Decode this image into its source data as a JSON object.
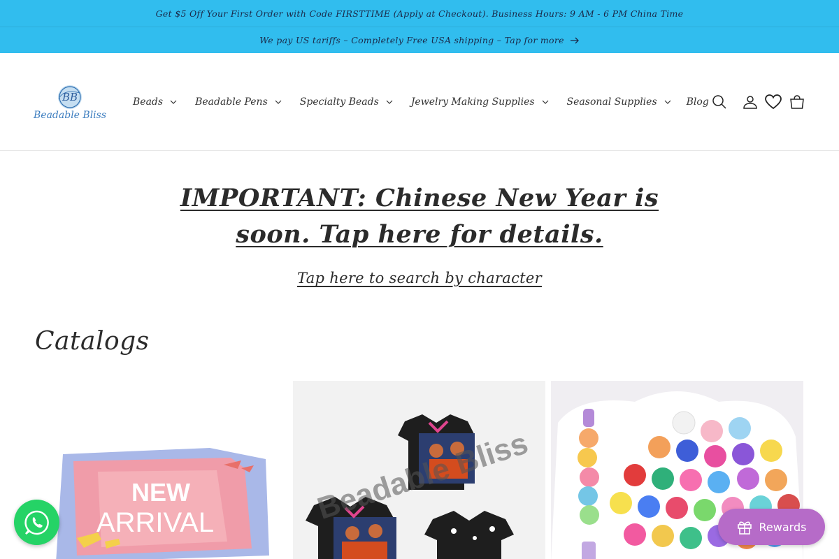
{
  "announcement_bar": {
    "promo_text": "Get $5 Off Your First Order with Code FIRSTTIME (Apply at Checkout). Business Hours: 9 AM - 6 PM China Time",
    "shipping_text": "We pay US tariffs – Completely Free USA shipping – Tap for more"
  },
  "header": {
    "logo": {
      "monogram": "BB",
      "text": "Beadable Bliss"
    },
    "nav": [
      {
        "label": "Beads"
      },
      {
        "label": "Beadable Pens"
      },
      {
        "label": "Specialty Beads"
      },
      {
        "label": "Jewelry Making Supplies"
      },
      {
        "label": "Seasonal Supplies"
      },
      {
        "label": "Blog"
      }
    ],
    "icons": [
      "search-icon",
      "account-icon",
      "heart-icon",
      "cart-icon"
    ]
  },
  "main": {
    "important_link": "IMPORTANT: Chinese New Year is soon. Tap here for details.",
    "search_by_character_link": "Tap here to search by character",
    "catalogs_heading": "Catalogs",
    "cards": [
      {
        "image_text_line1": "NEW",
        "image_text_line2": "ARRIVAL"
      },
      {
        "image_text": "Beadable Bliss"
      },
      {
        "image_text": ""
      }
    ]
  },
  "widgets": {
    "rewards_label": "Rewards",
    "whatsapp_icon": "whatsapp-icon"
  },
  "colors": {
    "announcement_bg": "#31bdee",
    "rewards_bg": "#b66bc8",
    "whatsapp_bg": "#25d366"
  }
}
